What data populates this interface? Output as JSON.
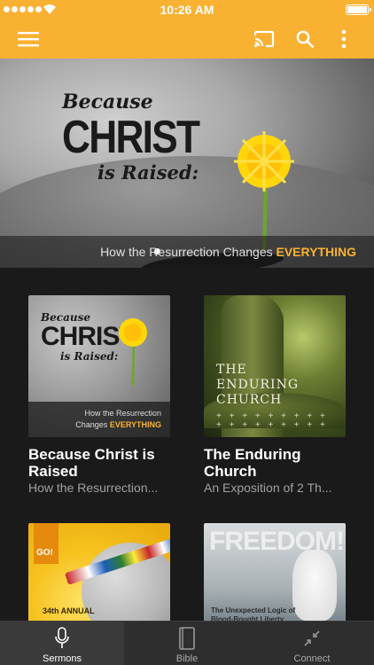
{
  "status_bar": {
    "time": "10:26 AM",
    "signal_icon": "signal-dots-icon",
    "wifi_icon": "wifi-icon",
    "battery_icon": "battery-icon"
  },
  "app_bar": {
    "background_color": "#f9b132",
    "menu_icon": "hamburger-menu-icon",
    "cast_icon": "cast-icon",
    "search_icon": "search-icon",
    "more_icon": "more-vertical-icon"
  },
  "hero": {
    "title_line1": "Because",
    "title_line2": "CHRIST",
    "title_line3": "is Raised:",
    "caption_prefix": "How the Resurrection Changes",
    "caption_emphasis": "EVERYTHING"
  },
  "series": [
    {
      "title": "Because Christ is Raised",
      "subtitle": "How the Resurrection...",
      "artwork": {
        "line1": "Because",
        "line2": "CHRIST",
        "line3": "is Raised:",
        "band_line1": "How the Resurrection",
        "band_line2_prefix": "Changes",
        "band_line2_emphasis": "EVERYTHING"
      }
    },
    {
      "title": "The Enduring Church",
      "subtitle": "An Exposition of 2 Th...",
      "artwork": {
        "line1": "THE",
        "line2": "ENDURING",
        "line3": "CHURCH",
        "crosses": "+ + + + + + + + +"
      }
    },
    {
      "title": "",
      "subtitle": "",
      "artwork": {
        "badge": "GO!",
        "annual": "34th ANNUAL"
      }
    },
    {
      "title": "",
      "subtitle": "",
      "artwork": {
        "headline": "FREEDOM!",
        "tagline_line1": "The Unexpected Logic of",
        "tagline_line2": "Blood-Bought Liberty"
      }
    }
  ],
  "tab_bar": {
    "tabs": [
      {
        "label": "Sermons",
        "icon": "microphone-icon",
        "active": true
      },
      {
        "label": "Bible",
        "icon": "book-icon",
        "active": false
      },
      {
        "label": "Connect",
        "icon": "connect-arrows-icon",
        "active": false
      }
    ]
  }
}
